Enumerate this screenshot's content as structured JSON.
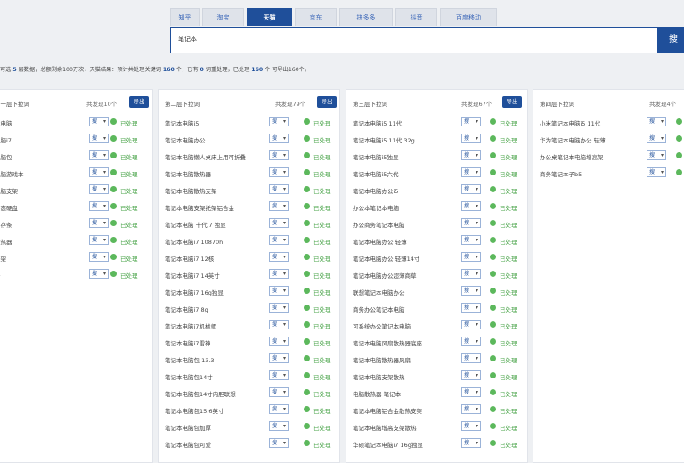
{
  "tabs": [
    "知乎",
    "淘宝",
    "天猫",
    "京东",
    "拼多多",
    "抖音",
    "百度移动"
  ],
  "active_tab": "天猫",
  "search": {
    "value": "笔记本",
    "button_label": "搜"
  },
  "info": {
    "p1": "可选 ",
    "n1": "5",
    "p2": " 层数据，总额剩余100万次，天猫结果：预计共处理关键词 ",
    "n2": "160",
    "p3": " 个，已有 ",
    "n3": "0",
    "p4": " 词重处理，已处理 ",
    "n4": "160",
    "p5": " 个 可导出160个。"
  },
  "row_ui": {
    "select_label": "搜",
    "status_label": "已处理"
  },
  "columns": [
    {
      "title": "第一层下拉词",
      "count": "共发现10个",
      "export_label": "导出",
      "items": [
        "本电脑",
        "电脑i7",
        "电脑包",
        "电脑游戏本",
        "电脑支架",
        "固态硬盘",
        "内存条",
        "散热器",
        "支架",
        "子"
      ]
    },
    {
      "title": "第二层下拉词",
      "count": "共发现79个",
      "export_label": "导出",
      "items": [
        "笔记本电脑i5",
        "笔记本电脑办公",
        "笔记本电脑懒人桌床上用可折叠",
        "笔记本电脑散热器",
        "笔记本电脑散热支架",
        "笔记本电脑支架托架铝合金",
        "笔记本电脑 十代i7 独显",
        "笔记本电脑i7 10870h",
        "笔记本电脑i7 12核",
        "笔记本电脑i7 14英寸",
        "笔记本电脑i7 16g独显",
        "笔记本电脑i7 8g",
        "笔记本电脑i7机械师",
        "笔记本电脑i7雷神",
        "笔记本电脑包 13.3",
        "笔记本电脑包14寸",
        "笔记本电脑包14寸内胆联想",
        "笔记本电脑包15.6英寸",
        "笔记本电脑包加厚",
        "笔记本电脑包可爱"
      ]
    },
    {
      "title": "第三层下拉词",
      "count": "共发现67个",
      "export_label": "导出",
      "items": [
        "笔记本电脑i5 11代",
        "笔记本电脑i5 11代 32g",
        "笔记本电脑i5独显",
        "笔记本电脑i5六代",
        "笔记本电脑办公i5",
        "办公本笔记本电脑",
        "办公商务笔记本电脑",
        "笔记本电脑办公 轻薄",
        "笔记本电脑办公 轻薄14寸",
        "笔记本电脑办公超薄商草",
        "联想笔记本电脑办公",
        "商务办公笔记本电脑",
        "可系统办公笔记本电脑",
        "笔记本电脑风扇散热器底座",
        "笔记本电脑散热器风扇",
        "笔记本电脑支架散热",
        "电脑散热器 笔记本",
        "笔记本电脑铝合金散热支架",
        "笔记本电脑增高支架散热",
        "华硕笔记本电脑i7 16g独显"
      ]
    },
    {
      "title": "第四层下拉词",
      "count": "共发现4个",
      "export_label": "导出",
      "items": [
        "小米笔记本电脑i5 11代",
        "华为笔记本电脑办公 轻薄",
        "办公桌笔记本电脑增高架",
        "商务笔记本子b5"
      ]
    }
  ]
}
